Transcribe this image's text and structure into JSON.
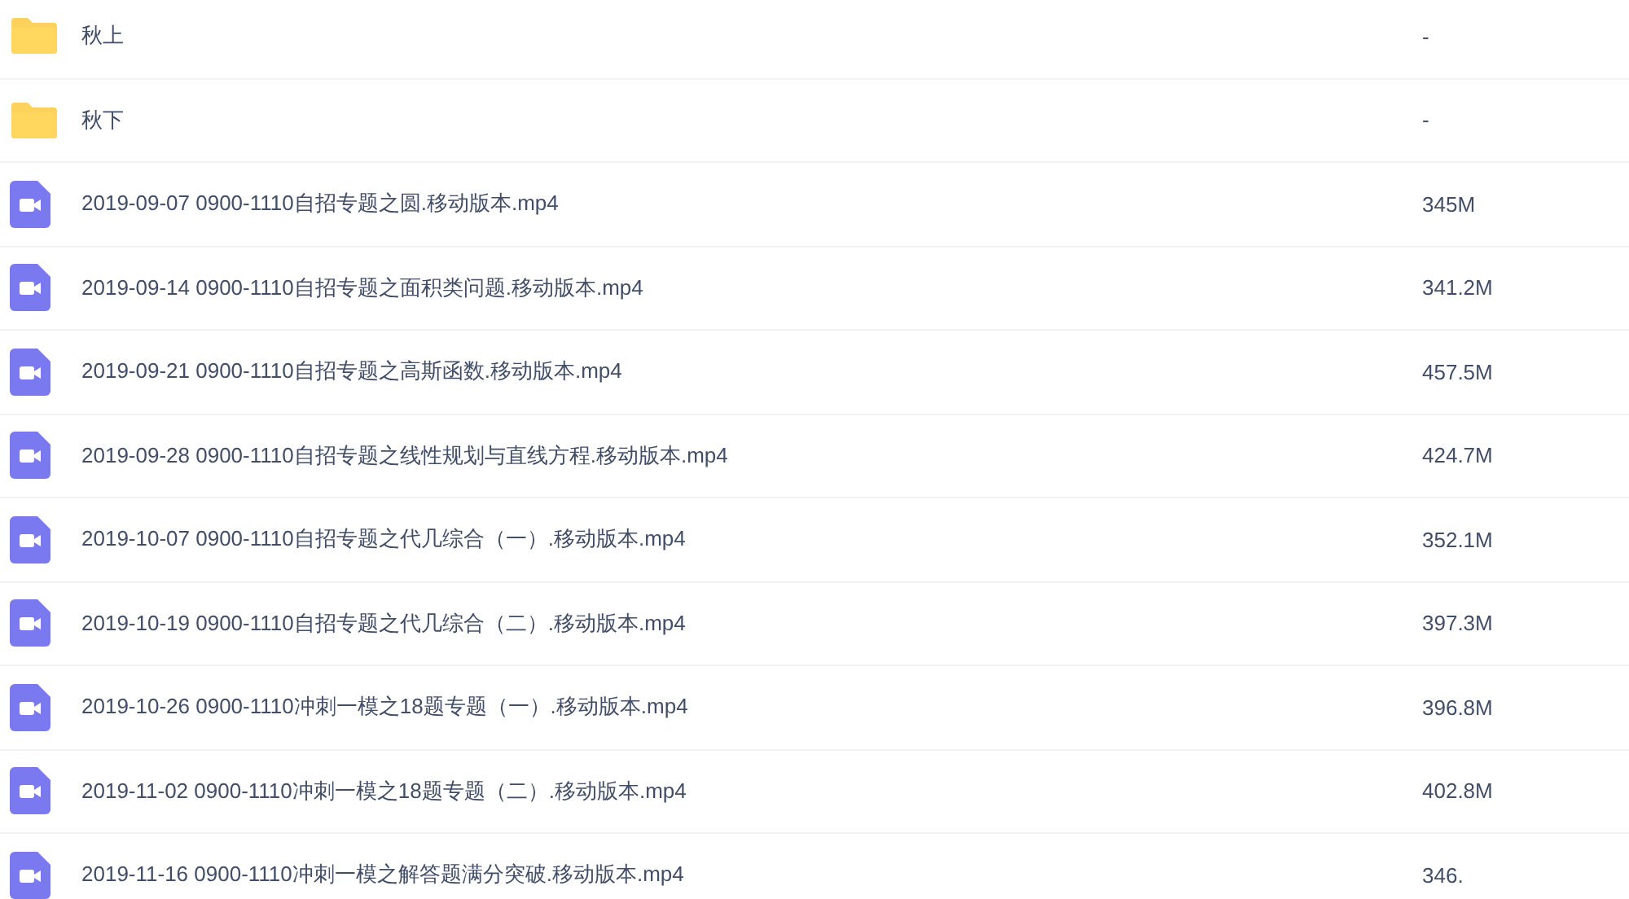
{
  "files": [
    {
      "kind": "folder",
      "name": "秋上",
      "size": "-"
    },
    {
      "kind": "folder",
      "name": "秋下",
      "size": "-"
    },
    {
      "kind": "video",
      "name": "2019-09-07 0900-1110自招专题之圆.移动版本.mp4",
      "size": "345M"
    },
    {
      "kind": "video",
      "name": "2019-09-14 0900-1110自招专题之面积类问题.移动版本.mp4",
      "size": "341.2M"
    },
    {
      "kind": "video",
      "name": "2019-09-21 0900-1110自招专题之高斯函数.移动版本.mp4",
      "size": "457.5M"
    },
    {
      "kind": "video",
      "name": "2019-09-28 0900-1110自招专题之线性规划与直线方程.移动版本.mp4",
      "size": "424.7M"
    },
    {
      "kind": "video",
      "name": "2019-10-07 0900-1110自招专题之代几综合（一）.移动版本.mp4",
      "size": "352.1M"
    },
    {
      "kind": "video",
      "name": "2019-10-19 0900-1110自招专题之代几综合（二）.移动版本.mp4",
      "size": "397.3M"
    },
    {
      "kind": "video",
      "name": "2019-10-26 0900-1110冲刺一模之18题专题（一）.移动版本.mp4",
      "size": "396.8M"
    },
    {
      "kind": "video",
      "name": "2019-11-02 0900-1110冲刺一模之18题专题（二）.移动版本.mp4",
      "size": "402.8M"
    },
    {
      "kind": "video",
      "name": "2019-11-16 0900-1110冲刺一模之解答题满分突破.移动版本.mp4",
      "size": "346."
    }
  ]
}
